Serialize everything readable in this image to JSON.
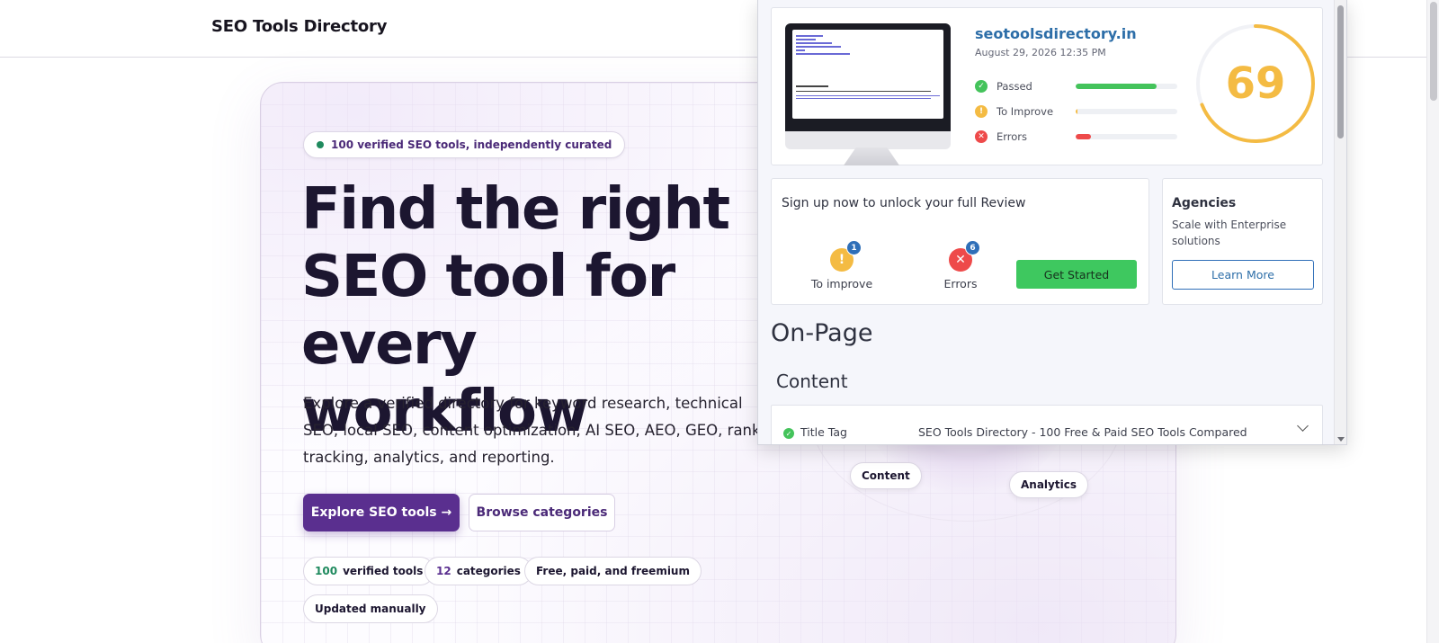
{
  "site": {
    "brand": "SEO Tools Directory"
  },
  "hero": {
    "badge": "100 verified SEO tools, independently curated",
    "title": "Find the right SEO tool for every workflow",
    "subtitle": "Explore a verified directory for keyword research, technical SEO, local SEO, content optimization, AI SEO, AEO, GEO, rank tracking, analytics, and reporting.",
    "primary_cta": "Explore SEO tools →",
    "secondary_cta": "Browse categories",
    "stats": [
      {
        "number": "100",
        "label": "verified tools"
      },
      {
        "number": "12",
        "label": "categories"
      },
      {
        "number": "",
        "label": "Free, paid, and freemium"
      },
      {
        "number": "",
        "label": "Updated manually"
      }
    ],
    "orbit_tags": [
      "Content",
      "Analytics"
    ]
  },
  "popup": {
    "site_url": "seotoolsdirectory.in",
    "date": "August 29, 2026 12:35 PM",
    "score": "69",
    "score_fraction": 0.69,
    "metrics": [
      {
        "label": "Passed",
        "fraction": 0.8,
        "color": "#44c35b"
      },
      {
        "label": "To Improve",
        "fraction": 0.02,
        "color": "#f4bb43"
      },
      {
        "label": "Errors",
        "fraction": 0.15,
        "color": "#ee4a4a"
      }
    ],
    "unlock": {
      "title": "Sign up now to unlock your full Review",
      "to_improve_count": "1",
      "to_improve_label": "To improve",
      "errors_count": "6",
      "errors_label": "Errors",
      "cta": "Get Started"
    },
    "agencies": {
      "title": "Agencies",
      "text": "Scale with Enterprise solutions",
      "cta": "Learn More"
    },
    "section_title": "On-Page",
    "subsection_title": "Content",
    "title_tag": {
      "label": "Title Tag",
      "value": "SEO Tools Directory - 100 Free & Paid SEO Tools Compared"
    }
  },
  "colors": {
    "accent": "#5a2f8f",
    "score": "#f4bb43",
    "link": "#2d6ea8"
  }
}
